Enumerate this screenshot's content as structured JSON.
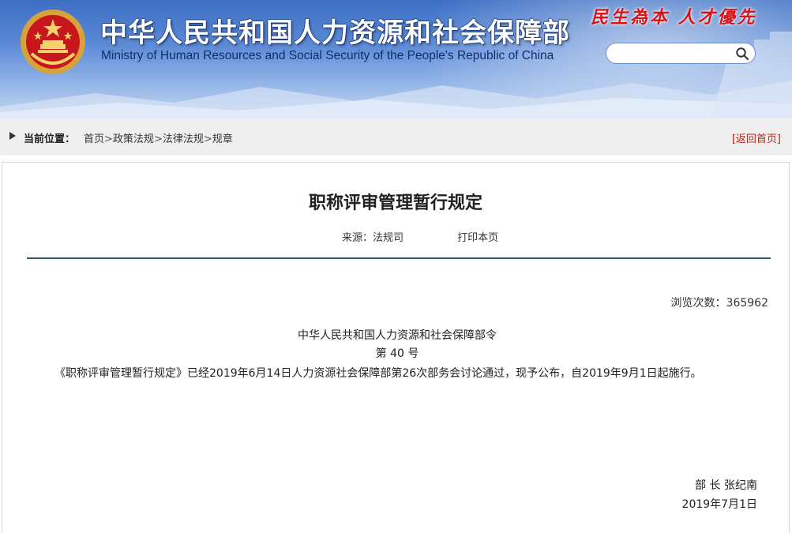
{
  "header": {
    "title_cn": "中华人民共和国人力资源和社会保障部",
    "title_en": "Ministry of Human Resources and Social Security of the People's Republic of China",
    "slogan": "民生為本 人才優先",
    "search": {
      "value": "",
      "placeholder": ""
    },
    "emblem_icon": "national-emblem-icon",
    "search_icon": "search-icon"
  },
  "breadcrumb": {
    "label": "当前位置：",
    "items": [
      "首页",
      "政策法规",
      "法律法规",
      "规章"
    ],
    "separator": ">",
    "back_link": "[返回首页]"
  },
  "article": {
    "title": "职称评审管理暂行规定",
    "source": "来源：法规司",
    "print": "打印本页",
    "views": "浏览次数：365962",
    "order_head": "中华人民共和国人力资源和社会保障部令",
    "order_no": "第 40 号",
    "paragraph": "《职称评审管理暂行规定》已经2019年6月14日人力资源社会保障部第26次部务会讨论通过，现予公布，自2019年9月1日起施行。",
    "sign_name": "部 长 张纪南",
    "sign_date": "2019年7月1日"
  },
  "colors": {
    "banner_top": "#3d6fc4",
    "slogan": "#d8141b",
    "back_link": "#c0221c",
    "divider": "#2d5b7b"
  }
}
